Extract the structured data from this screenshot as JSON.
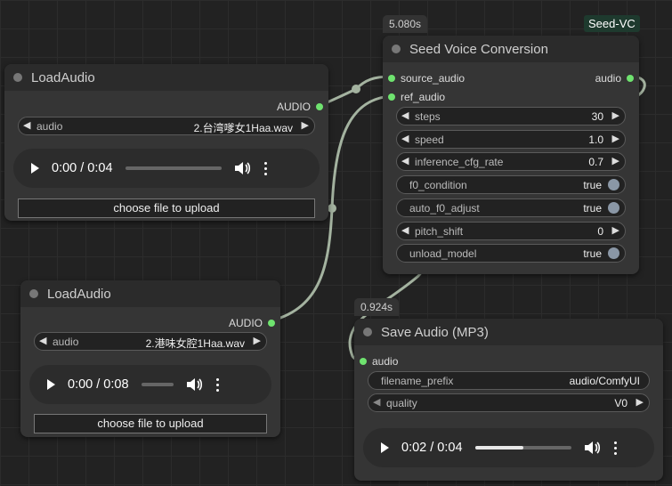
{
  "colors": {
    "canvas": "#222222",
    "node": "#353535",
    "slot_dot": "#6fe36f",
    "wire": "#a4b3a0"
  },
  "load_audio_1": {
    "title": "LoadAudio",
    "output_label": "AUDIO",
    "combo_label": "audio",
    "combo_value": "2.台湾嗲女1Haa.wav",
    "player": {
      "time": "0:00 / 0:04",
      "progress": 0.0
    },
    "upload_label": "choose file to upload"
  },
  "load_audio_2": {
    "title": "LoadAudio",
    "output_label": "AUDIO",
    "combo_label": "audio",
    "combo_value": "2.港味女腔1Haa.wav",
    "player": {
      "time": "0:00 / 0:08",
      "progress": 0.0
    },
    "upload_label": "choose file to upload"
  },
  "seed_vc": {
    "badge_time": "5.080s",
    "group_tag": "Seed-VC",
    "title": "Seed Voice Conversion",
    "inputs": [
      "source_audio",
      "ref_audio"
    ],
    "output_label": "audio",
    "widgets": [
      {
        "type": "number",
        "label": "steps",
        "value": "30"
      },
      {
        "type": "number",
        "label": "speed",
        "value": "1.0"
      },
      {
        "type": "number",
        "label": "inference_cfg_rate",
        "value": "0.7"
      },
      {
        "type": "toggle",
        "label": "f0_condition",
        "value": "true"
      },
      {
        "type": "toggle",
        "label": "auto_f0_adjust",
        "value": "true"
      },
      {
        "type": "number",
        "label": "pitch_shift",
        "value": "0"
      },
      {
        "type": "toggle",
        "label": "unload_model",
        "value": "true"
      }
    ]
  },
  "save_audio": {
    "badge_time": "0.924s",
    "title": "Save Audio (MP3)",
    "input_label": "audio",
    "filename_prefix_label": "filename_prefix",
    "filename_prefix_value": "audio/ComfyUI",
    "quality_label": "quality",
    "quality_value": "V0",
    "player": {
      "time": "0:02 / 0:04",
      "progress": 0.5
    }
  },
  "icons": {
    "play": "play-icon",
    "volume": "volume-icon",
    "more": "kebab-menu-icon",
    "arrow_left": "◀",
    "arrow_right": "▶"
  }
}
